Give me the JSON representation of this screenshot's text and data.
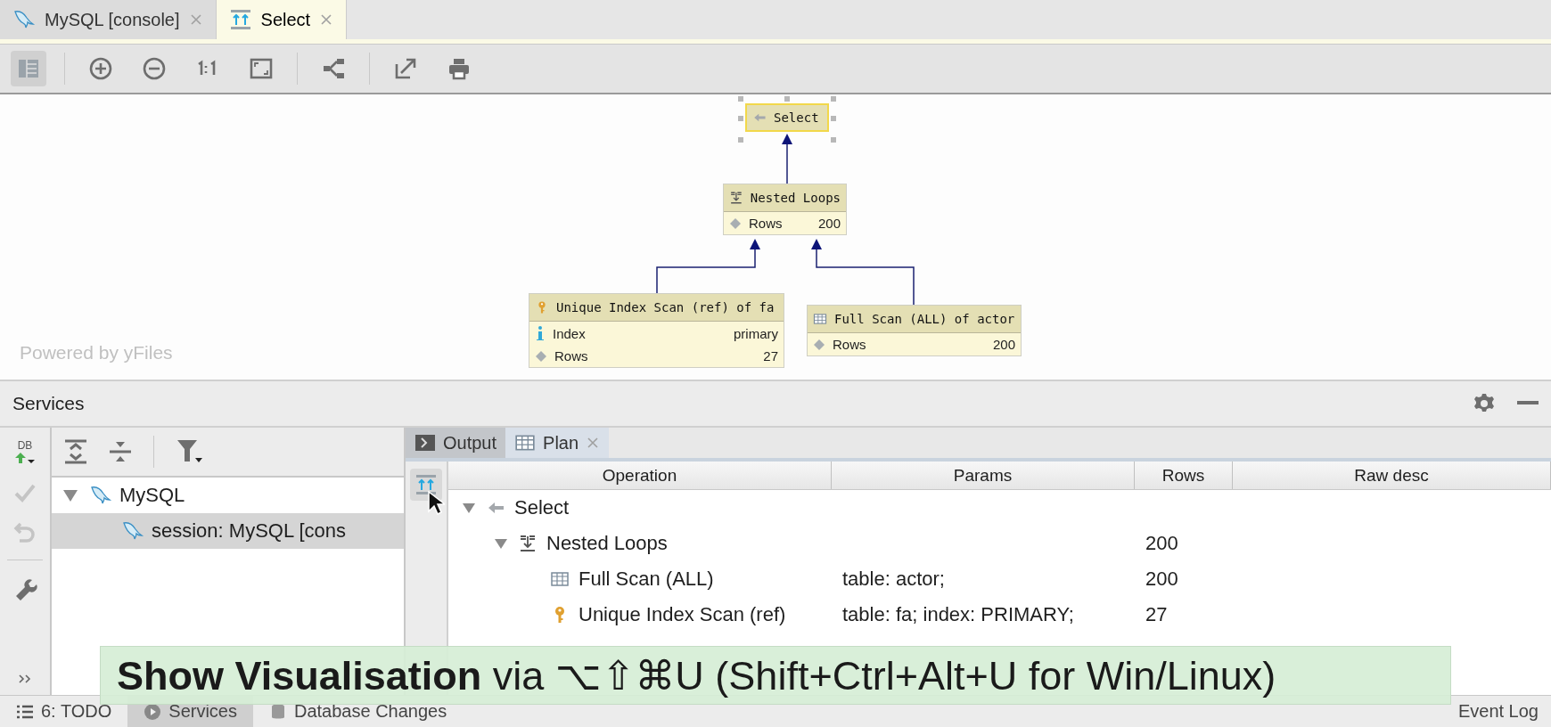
{
  "editor_tabs": [
    {
      "label": "MySQL [console]",
      "kind": "mysql",
      "selected": false,
      "closable": true
    },
    {
      "label": "Select",
      "kind": "plan",
      "selected": true,
      "closable": true
    }
  ],
  "toolbar": [
    {
      "kind": "layout",
      "selected": true
    },
    {
      "kind": "zoom-in",
      "selected": false
    },
    {
      "kind": "zoom-out",
      "selected": false
    },
    {
      "kind": "actual-size",
      "selected": false
    },
    {
      "kind": "fit",
      "selected": false
    },
    {
      "kind": "hierarchy",
      "selected": false
    },
    {
      "kind": "export",
      "selected": false
    },
    {
      "kind": "print",
      "selected": false
    }
  ],
  "diagram": {
    "watermark": "Powered by yFiles",
    "nodes": [
      {
        "kind": "select",
        "title": "Select",
        "selected": true
      },
      {
        "kind": "nested",
        "title": "Nested Loops",
        "selected": false,
        "props": [
          {
            "kind": "rows",
            "label": "Rows",
            "value": "200"
          }
        ]
      },
      {
        "kind": "index",
        "title": "Unique Index Scan (ref) of fa",
        "selected": false,
        "props": [
          {
            "kind": "info",
            "label": "Index",
            "value": "primary"
          },
          {
            "kind": "rows",
            "label": "Rows",
            "value": "27"
          }
        ]
      },
      {
        "kind": "table",
        "title": "Full Scan (ALL) of actor",
        "selected": false,
        "props": [
          {
            "kind": "rows",
            "label": "Rows",
            "value": "200"
          }
        ]
      }
    ]
  },
  "services": {
    "title": "Services",
    "db_label": "DB",
    "tree": [
      {
        "label": "MySQL",
        "selected": false,
        "expanded": true,
        "children": [
          {
            "label": "session: MySQL [cons",
            "selected": true
          }
        ]
      }
    ],
    "result_tabs": [
      {
        "label": "Output",
        "kind": "output",
        "selected": false,
        "closable": false
      },
      {
        "label": "Plan",
        "kind": "plan",
        "selected": true,
        "closable": true
      }
    ],
    "plan_table": {
      "columns": [
        "Operation",
        "Params",
        "Rows",
        "Raw desc"
      ],
      "rows": [
        {
          "kind": "select",
          "operation": "Select",
          "expanded": true,
          "children": [
            {
              "kind": "nested",
              "operation": "Nested Loops",
              "rows": "200",
              "expanded": true,
              "children": [
                {
                  "kind": "table",
                  "operation": "Full Scan (ALL)",
                  "params": "table: actor;",
                  "rows": "200"
                },
                {
                  "kind": "index",
                  "operation": "Unique Index Scan (ref)",
                  "params": "table: fa; index: PRIMARY;",
                  "rows": "27"
                }
              ]
            }
          ]
        }
      ]
    }
  },
  "status_bar": {
    "items": [
      {
        "kind": "todo",
        "label": "6: TODO",
        "selected": false
      },
      {
        "kind": "services",
        "label": "Services",
        "selected": true
      },
      {
        "kind": "db",
        "label": "Database Changes",
        "selected": false
      }
    ],
    "right": "Event Log"
  },
  "banner": {
    "text": "**Show Visualisation** via ⌥⇧⌘U (Shift+Ctrl+Alt+U for Win/Linux)"
  }
}
